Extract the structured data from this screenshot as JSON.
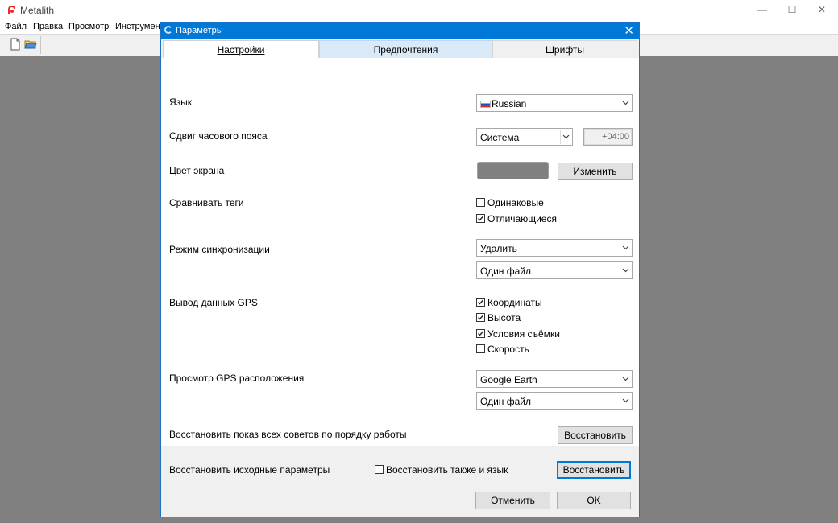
{
  "app": {
    "title": "Metalith",
    "menu": [
      "Файл",
      "Правка",
      "Просмотр",
      "Инструменты"
    ],
    "window_controls": {
      "minimize": "—",
      "maximize": "☐",
      "close": "✕"
    }
  },
  "dialog": {
    "title": "Параметры",
    "close": "✕",
    "tabs": [
      "Настройки",
      "Предпочтения",
      "Шрифты"
    ],
    "active_tab": "Настройки",
    "settings": {
      "language_label": "Язык",
      "language_value": "Russian",
      "timezone_label": "Сдвиг часового пояса",
      "timezone_mode": "Система",
      "timezone_offset": "+04:00",
      "screen_color_label": "Цвет экрана",
      "screen_color": "#808080",
      "change_button": "Изменить",
      "compare_tags_label": "Сравнивать теги",
      "compare_options": [
        {
          "label": "Одинаковые",
          "checked": false
        },
        {
          "label": "Отличающиеся",
          "checked": true
        }
      ],
      "sync_mode_label": "Режим синхронизации",
      "sync_action": "Удалить",
      "sync_file": "Один файл",
      "gps_output_label": "Вывод данных GPS",
      "gps_options": [
        {
          "label": "Координаты",
          "checked": true
        },
        {
          "label": "Высота",
          "checked": true
        },
        {
          "label": "Условия съёмки",
          "checked": true
        },
        {
          "label": "Скорость",
          "checked": false
        }
      ],
      "gps_view_label": "Просмотр GPS расположения",
      "gps_view_app": "Google Earth",
      "gps_view_file": "Один файл",
      "restore_tips_label": "Восстановить показ всех советов по порядку работы",
      "restore_tips_button": "Восстановить"
    },
    "footer": {
      "restore_defaults_label": "Восстановить исходные параметры",
      "restore_language_checkbox": "Восстановить также и язык",
      "restore_language_checked": false,
      "restore_button": "Восстановить",
      "cancel_button": "Отменить",
      "ok_button": "OK"
    }
  },
  "colors": {
    "accent": "#0078d7",
    "background": "#808080",
    "tab_hover": "#d9e9f7"
  }
}
